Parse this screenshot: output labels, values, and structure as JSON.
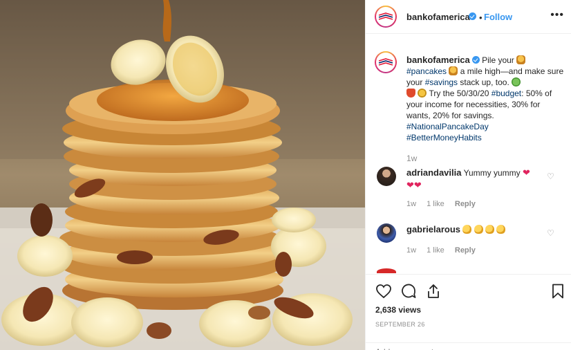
{
  "post": {
    "username": "bankofamerica",
    "follow_label": "Follow",
    "separator": "•",
    "more_label": "•••"
  },
  "caption": {
    "username": "bankofamerica",
    "parts": {
      "t1": "Pile your",
      "h1": "#pancakes",
      "t2": "a mile high—and make sure your",
      "h2": "#savings",
      "t3": "stack up, too.",
      "t4": "Try the 50/30/20",
      "h3": "#budget",
      "t5": ": 50% of your income for necessities, 30% for wants, 20% for savings.",
      "h4": "#NationalPancakeDay",
      "h5": "#BetterMoneyHabits"
    },
    "time": "1w"
  },
  "comments": [
    {
      "username": "adriandavilia",
      "text": "Yummy yummy",
      "time": "1w",
      "likes": "1 like",
      "reply_label": "Reply"
    },
    {
      "username": "gabrielarous",
      "text": "",
      "time": "1w",
      "likes": "1 like",
      "reply_label": "Reply"
    }
  ],
  "stats": {
    "views": "2,638 views",
    "date": "SEPTEMBER 26"
  },
  "add_comment": {
    "placeholder": "Add a comment..."
  },
  "colors": {
    "accent": "#3897f0",
    "hashtag": "#00376b",
    "muted": "#8e8e8e",
    "brand_red": "#e31837",
    "brand_blue": "#012169"
  },
  "icons": [
    "bankofamerica-logo-icon",
    "verified-icon",
    "more-icon",
    "heart-icon",
    "comment-icon",
    "share-icon",
    "bookmark-icon"
  ]
}
